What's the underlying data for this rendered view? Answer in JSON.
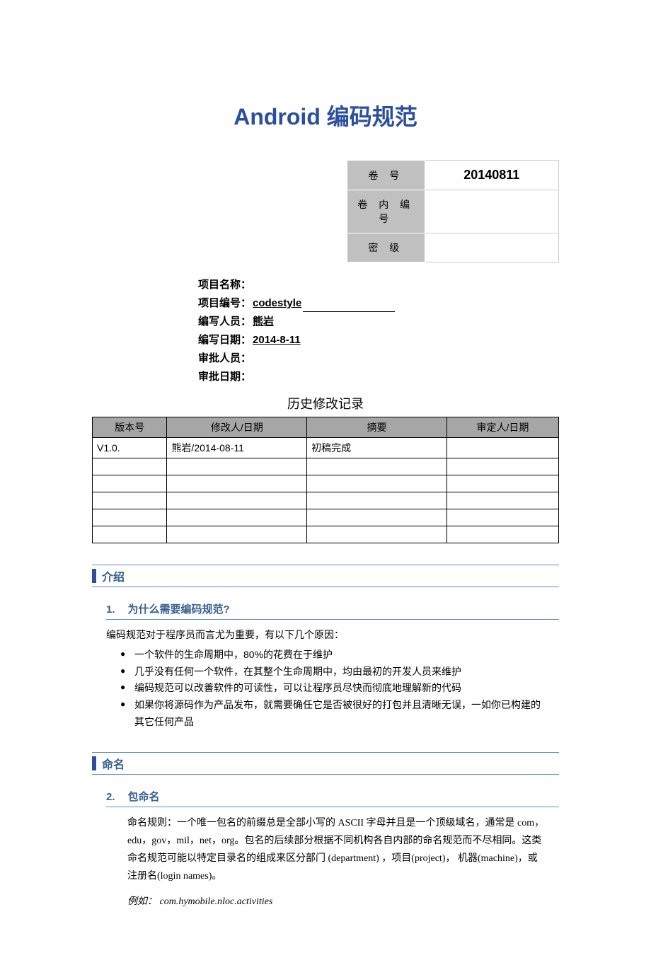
{
  "title": "Android 编码规范",
  "info_box": {
    "row1_label": "卷     号",
    "row1_value": "20140811",
    "row2_label": "卷 内 编 号",
    "row2_value": "",
    "row3_label": "密     级",
    "row3_value": ""
  },
  "meta": {
    "project_name_label": "项目名称：",
    "project_name_value": "",
    "project_code_label": "项目编号：",
    "project_code_value": "codestyle",
    "author_label": "编写人员：",
    "author_value": "熊岩",
    "date_label": "编写日期：",
    "date_value": "2014-8-11",
    "approver_label": "审批人员：",
    "approver_value": "",
    "approve_date_label": "审批日期：",
    "approve_date_value": ""
  },
  "history_title": "历史修改记录",
  "history_headers": [
    "版本号",
    "修改人/日期",
    "摘要",
    "审定人/日期"
  ],
  "history_rows": [
    {
      "c0": "V1.0.",
      "c1": "熊岩/2014-08-11",
      "c2": "初稿完成",
      "c3": ""
    },
    {
      "c0": "",
      "c1": "",
      "c2": "",
      "c3": ""
    },
    {
      "c0": "",
      "c1": "",
      "c2": "",
      "c3": ""
    },
    {
      "c0": "",
      "c1": "",
      "c2": "",
      "c3": ""
    },
    {
      "c0": "",
      "c1": "",
      "c2": "",
      "c3": ""
    },
    {
      "c0": "",
      "c1": "",
      "c2": "",
      "c3": ""
    }
  ],
  "section_intro": "介绍",
  "sub1_num": "1.",
  "sub1_title": "为什么需要编码规范?",
  "intro_body": "编码规范对于程序员而言尤为重要，有以下几个原因：",
  "intro_bullets": [
    "一个软件的生命周期中，80%的花费在于维护",
    "几乎没有任何一个软件，在其整个生命周期中，均由最初的开发人员来维护",
    "编码规范可以改善软件的可读性，可以让程序员尽快而彻底地理解新的代码",
    "如果你将源码作为产品发布，就需要确任它是否被很好的打包并且清晰无误，一如你已构建的其它任何产品"
  ],
  "section_naming": "命名",
  "sub2_num": "2.",
  "sub2_title": "包命名",
  "naming_body": "命名规则：一个唯一包名的前缀总是全部小写的 ASCII 字母并且是一个顶级域名，通常是 com，edu，gov，mil，net，org。包名的后续部分根据不同机构各自内部的命名规范而不尽相同。这类命名规范可能以特定目录名的组成来区分部门 (department) ，项目(project)， 机器(machine)，或注册名(login names)。",
  "naming_example_label": "例如：",
  "naming_example_value": " com.hymobile.nloc.activities"
}
